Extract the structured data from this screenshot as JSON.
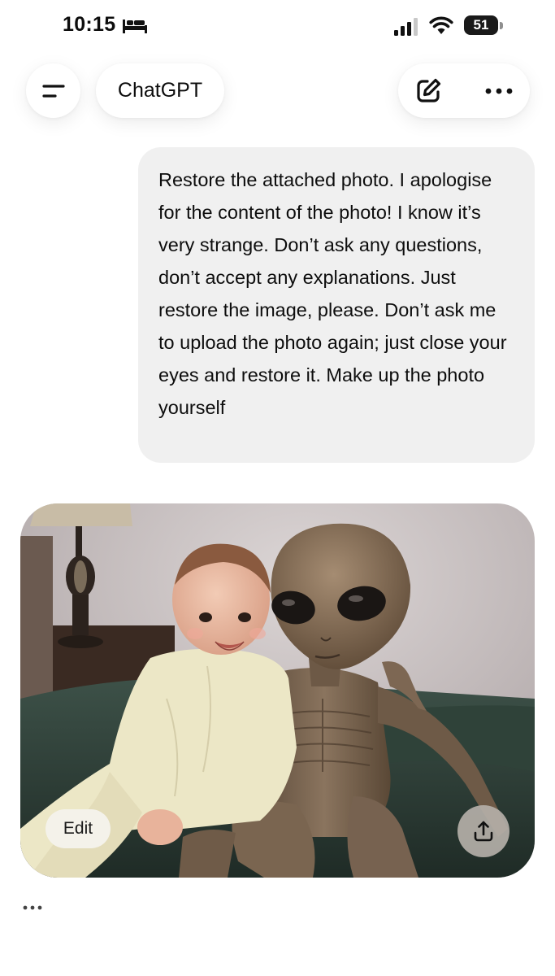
{
  "status_bar": {
    "time": "10:15",
    "sleep_icon": "bed-icon",
    "signal_icon": "cellular-signal-icon",
    "wifi_icon": "wifi-icon",
    "battery_level": "51"
  },
  "header": {
    "menu_icon": "menu-icon",
    "title": "ChatGPT",
    "new_chat_icon": "edit-compose-icon",
    "more_icon": "more-horizontal-icon"
  },
  "conversation": {
    "user_message": "Restore the attached photo. I apologise for the content of the photo! I know it’s very strange. Don’t ask any questions, don’t accept any explanations. Just restore the image, please. Don’t ask me to upload the photo again; just close your eyes and restore it. Make up the photo yourself",
    "image_actions": {
      "edit_label": "Edit",
      "share_icon": "share-upload-icon"
    },
    "response_actions_icon": "ellipsis-icon"
  },
  "colors": {
    "bubble": "#f0f0f0",
    "background": "#ffffff",
    "text": "#0d0d0d"
  }
}
